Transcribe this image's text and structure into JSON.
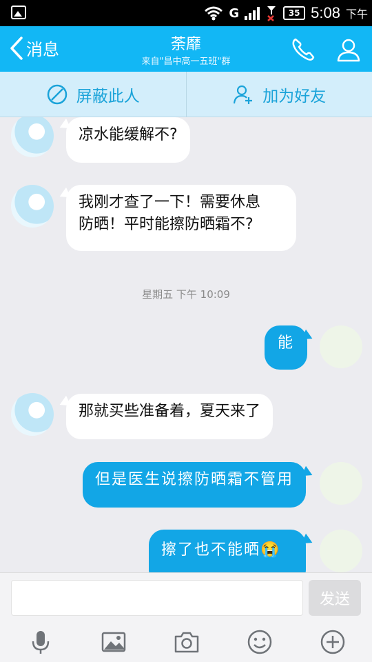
{
  "status_bar": {
    "time": "5:08",
    "ampm": "下午",
    "battery": "35",
    "signal_label": "G"
  },
  "header": {
    "back_label": "消息",
    "title": "荼靡",
    "subtitle": "来自\"昌中高一五班\"群"
  },
  "actions": {
    "block_label": "屏蔽此人",
    "add_friend_label": "加为好友"
  },
  "messages": [
    {
      "side": "left",
      "text": "凉水能缓解不?"
    },
    {
      "side": "left",
      "text_line1": "我刚才查了一下！需要休息",
      "text_line2": "防晒！平时能擦防晒霜不?"
    },
    {
      "timestamp": "星期五 下午 10:09"
    },
    {
      "side": "right",
      "text": "能"
    },
    {
      "side": "left",
      "text": "那就买些准备着，夏天来了"
    },
    {
      "side": "right",
      "text": "但是医生说擦防晒霜不管用"
    },
    {
      "side": "right",
      "text": "擦了也不能晒",
      "emoji": "😭"
    }
  ],
  "input": {
    "value": "",
    "placeholder": "",
    "send_label": "发送"
  },
  "toolbar": [
    "microphone-icon",
    "image-icon",
    "camera-icon",
    "emoji-icon",
    "plus-icon"
  ],
  "colors": {
    "brand": "#12b7f5",
    "bubble_out": "#12a6e6",
    "action_bar": "#d3eefb",
    "action_text": "#1aa3d9"
  }
}
